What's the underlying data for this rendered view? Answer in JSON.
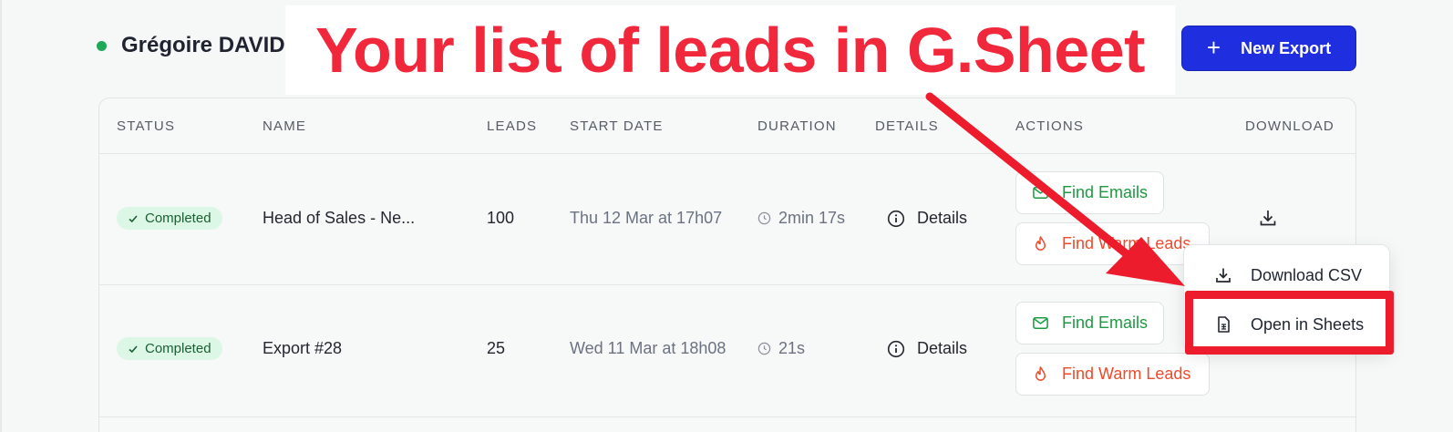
{
  "user": {
    "name": "Grégoire DAVID"
  },
  "toolbar": {
    "new_export_plus": "+",
    "new_export_label": "New Export"
  },
  "callout": {
    "text": "Your list of leads in G.Sheet"
  },
  "table": {
    "headers": {
      "status": "STATUS",
      "name": "NAME",
      "leads": "LEADS",
      "start_date": "START DATE",
      "duration": "DURATION",
      "details": "DETAILS",
      "actions": "ACTIONS",
      "download": "DOWNLOAD"
    },
    "rows": [
      {
        "status": "Completed",
        "name": "Head of Sales - Ne...",
        "leads": "100",
        "start_date": "Thu 12 Mar at 17h07",
        "duration": "2min 17s",
        "details": "Details",
        "find_emails": "Find Emails",
        "find_warm_leads": "Find Warm Leads"
      },
      {
        "status": "Completed",
        "name": "Export #28",
        "leads": "25",
        "start_date": "Wed 11 Mar at 18h08",
        "duration": "21s",
        "details": "Details",
        "find_emails": "Find Emails",
        "find_warm_leads": "Find Warm Leads"
      }
    ]
  },
  "download_menu": {
    "items": [
      {
        "label": "Download CSV",
        "icon": "download-icon"
      },
      {
        "label": "Open in Sheets",
        "icon": "sheet-icon"
      }
    ]
  },
  "colors": {
    "primary": "#1f2fe0",
    "success": "#1c9a3f",
    "warm": "#ef4a2a",
    "annotation": "#ec1c2c",
    "status_dot": "#1fa855"
  }
}
